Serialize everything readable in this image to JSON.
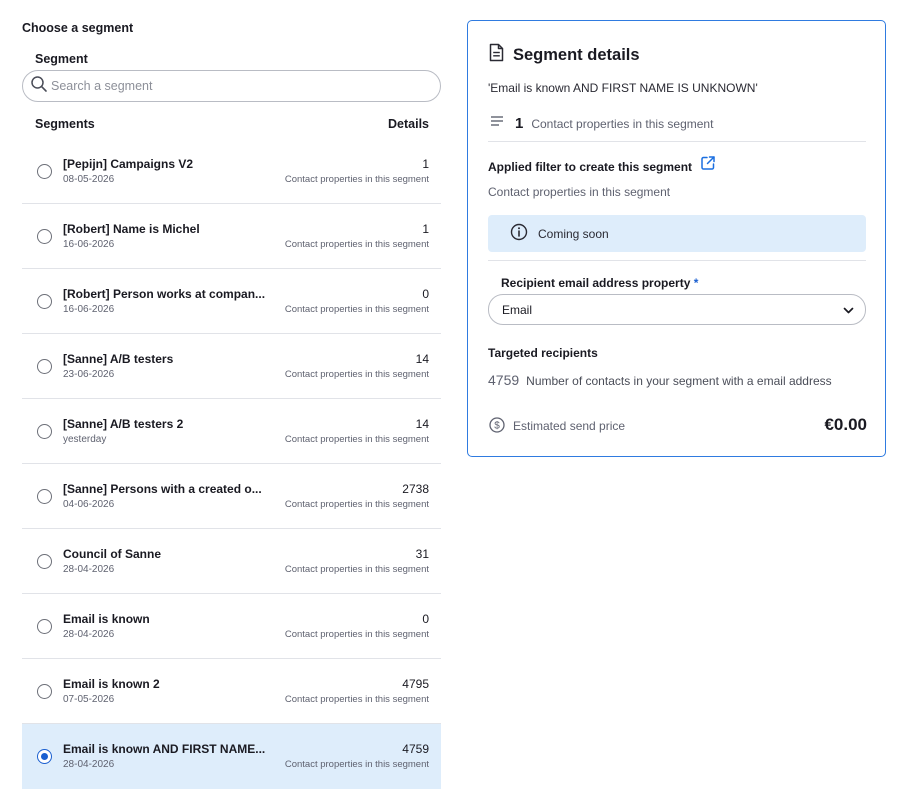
{
  "left_panel": {
    "title": "Choose a segment",
    "search_label": "Segment",
    "search_placeholder": "Search a segment",
    "list_header_segments": "Segments",
    "list_header_details": "Details",
    "rows": [
      {
        "name": "[Pepijn] Campaigns V2",
        "date": "08-05-2026",
        "count": "1",
        "caption": "Contact properties in this segment",
        "selected": false
      },
      {
        "name": "[Robert] Name is Michel",
        "date": "16-06-2026",
        "count": "1",
        "caption": "Contact properties in this segment",
        "selected": false
      },
      {
        "name": "[Robert] Person works at compan...",
        "date": "16-06-2026",
        "count": "0",
        "caption": "Contact properties in this segment",
        "selected": false
      },
      {
        "name": "[Sanne] A/B testers",
        "date": "23-06-2026",
        "count": "14",
        "caption": "Contact properties in this segment",
        "selected": false
      },
      {
        "name": "[Sanne] A/B testers 2",
        "date": "yesterday",
        "count": "14",
        "caption": "Contact properties in this segment",
        "selected": false
      },
      {
        "name": "[Sanne] Persons with a created o...",
        "date": "04-06-2026",
        "count": "2738",
        "caption": "Contact properties in this segment",
        "selected": false
      },
      {
        "name": "Council of Sanne",
        "date": "28-04-2026",
        "count": "31",
        "caption": "Contact properties in this segment",
        "selected": false
      },
      {
        "name": "Email is known",
        "date": "28-04-2026",
        "count": "0",
        "caption": "Contact properties in this segment",
        "selected": false
      },
      {
        "name": "Email is known 2",
        "date": "07-05-2026",
        "count": "4795",
        "caption": "Contact properties in this segment",
        "selected": false
      },
      {
        "name": "Email is known AND FIRST NAME...",
        "date": "28-04-2026",
        "count": "4759",
        "caption": "Contact properties in this segment",
        "selected": true
      }
    ]
  },
  "details": {
    "title": "Segment details",
    "segment_name": "'Email is known AND FIRST NAME IS UNKNOWN'",
    "property_count": "1",
    "property_caption": "Contact properties in this segment",
    "filter_heading": "Applied filter to create this segment",
    "filter_subtext": "Contact properties in this segment",
    "coming_soon": "Coming soon",
    "recipient_label": "Recipient email address property",
    "required_mark": "*",
    "recipient_value": "Email",
    "targeted_heading": "Targeted recipients",
    "targeted_count": "4759",
    "targeted_caption": "Number of contacts in your segment with a email address",
    "price_label": "Estimated send price",
    "price_value": "€0.00"
  },
  "colors": {
    "accent": "#1a5fd0",
    "card_border": "#2f7be0",
    "selected_row_bg": "#deedfb",
    "info_bg": "#deedfb"
  },
  "icons": {
    "search": "search-icon",
    "document": "document-icon",
    "list": "list-icon",
    "external_link": "external-link-icon",
    "info": "info-icon",
    "chevron": "chevron-down-icon",
    "dollar": "dollar-circle-icon"
  }
}
